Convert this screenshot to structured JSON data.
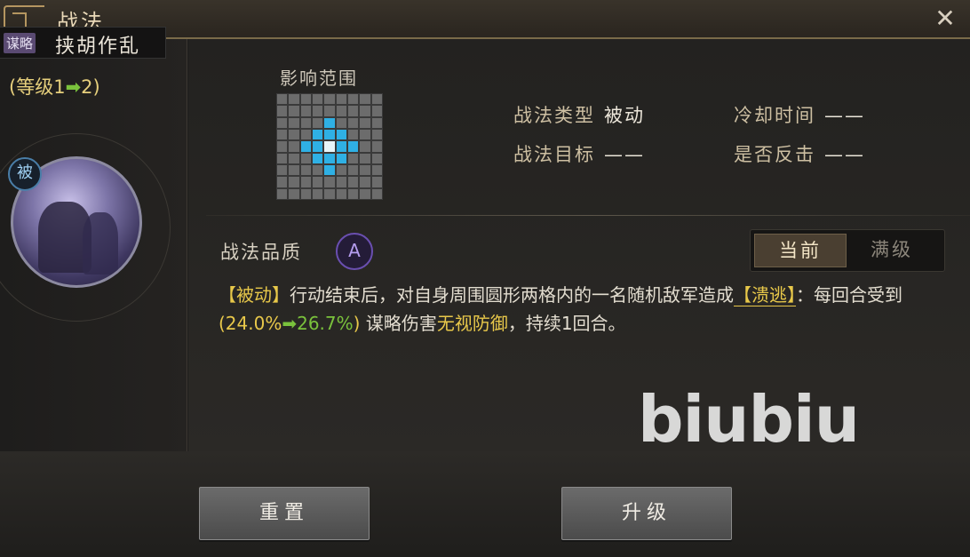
{
  "window": {
    "title": "战法",
    "close_icon": "close-icon"
  },
  "skill": {
    "type_tag": "谋略",
    "name": "挟胡作乱",
    "level_open": "(等级1",
    "level_arrow": "➡",
    "level_close": "2)",
    "passive_badge": "被"
  },
  "range": {
    "label": "影响范围",
    "grid_size": 9,
    "highlight_cells": [
      [
        2,
        4
      ],
      [
        3,
        3
      ],
      [
        3,
        4
      ],
      [
        3,
        5
      ],
      [
        4,
        2
      ],
      [
        4,
        3
      ],
      [
        4,
        5
      ],
      [
        4,
        6
      ],
      [
        5,
        3
      ],
      [
        5,
        4
      ],
      [
        5,
        5
      ],
      [
        6,
        4
      ]
    ],
    "center_cell": [
      4,
      4
    ]
  },
  "info": {
    "type_key": "战法类型",
    "type_val": "被动",
    "cooldown_key": "冷却时间",
    "cooldown_val": "——",
    "target_key": "战法目标",
    "target_val": "——",
    "counter_key": "是否反击",
    "counter_val": "——"
  },
  "quality": {
    "label": "战法品质",
    "grade": "A"
  },
  "toggle": {
    "current": "当前",
    "max": "满级"
  },
  "description": {
    "tag": "【被动】",
    "text1": "行动结束后，对自身周围圆形两格内的一名随机敌军造成",
    "status": "【溃逃】",
    "text2": "：每回合受到",
    "rate_open": "(24.0%",
    "rate_arrow": "➡",
    "rate_new": "26.7%",
    "rate_close": ")",
    "text3": "谋略伤害",
    "ignore": "无视防御",
    "text4": "，持续1回合。"
  },
  "watermark": "biubiu",
  "buttons": {
    "reset": "重置",
    "upgrade": "升级"
  },
  "colors": {
    "accent_yellow": "#e8c84a",
    "accent_green": "#7ac23c",
    "range_blue": "#2fb0e4"
  }
}
